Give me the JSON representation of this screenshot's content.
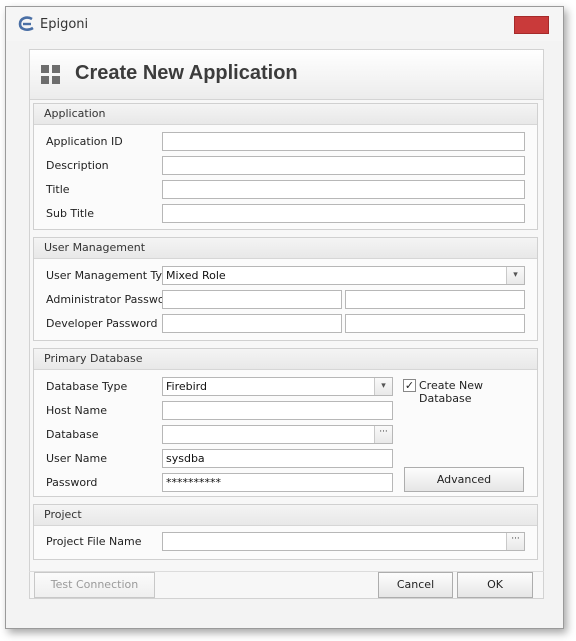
{
  "window": {
    "title": "Epigoni",
    "close_glyph": "✕"
  },
  "header": {
    "title": "Create New Application",
    "icon": "grid-icon"
  },
  "application": {
    "section_title": "Application",
    "application_id_label": "Application ID",
    "application_id_value": "",
    "description_label": "Description",
    "description_value": "",
    "title_label": "Title",
    "title_value": "",
    "subtitle_label": "Sub Title",
    "subtitle_value": ""
  },
  "user_management": {
    "section_title": "User Management",
    "type_label": "User Management Type",
    "type_value": "Mixed Role",
    "admin_password_label": "Administrator Password",
    "developer_password_label": "Developer Password"
  },
  "primary_database": {
    "section_title": "Primary Database",
    "type_label": "Database Type",
    "type_value": "Firebird",
    "create_new_label": "Create New Database",
    "create_new_checked": true,
    "host_label": "Host Name",
    "host_value": "",
    "database_label": "Database",
    "database_value": "",
    "username_label": "User Name",
    "username_value": "sysdba",
    "password_label": "Password",
    "password_value": "**********",
    "advanced_label": "Advanced"
  },
  "project": {
    "section_title": "Project",
    "file_label": "Project File Name",
    "file_value": ""
  },
  "footer": {
    "test_connection_label": "Test Connection",
    "cancel_label": "Cancel",
    "ok_label": "OK"
  },
  "glyphs": {
    "dropdown": "▾",
    "ellipsis": "···",
    "check": "✓"
  }
}
